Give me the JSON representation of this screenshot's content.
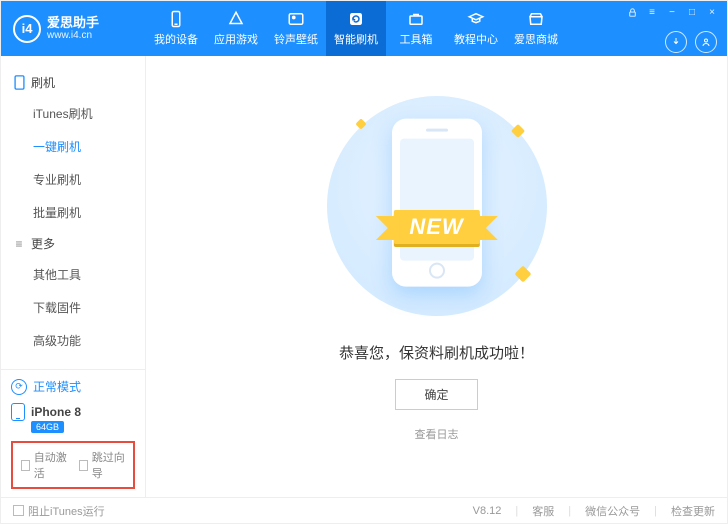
{
  "app": {
    "name": "爱思助手",
    "url": "www.i4.cn",
    "logo_text": "i4"
  },
  "nav": {
    "items": [
      {
        "label": "我的设备"
      },
      {
        "label": "应用游戏"
      },
      {
        "label": "铃声壁纸"
      },
      {
        "label": "智能刷机"
      },
      {
        "label": "工具箱"
      },
      {
        "label": "教程中心"
      },
      {
        "label": "爱思商城"
      }
    ],
    "active_index": 3
  },
  "window_controls": {
    "lock": "锁",
    "menu": "≡",
    "min": "−",
    "max": "□",
    "close": "×"
  },
  "sidebar": {
    "group1": {
      "title": "刷机",
      "items": [
        "iTunes刷机",
        "一键刷机",
        "专业刷机",
        "批量刷机"
      ],
      "active_index": 1
    },
    "group2": {
      "title": "更多",
      "items": [
        "其他工具",
        "下载固件",
        "高级功能"
      ]
    },
    "mode": {
      "label": "正常模式"
    },
    "device": {
      "name": "iPhone 8",
      "storage": "64GB"
    },
    "options": {
      "auto_activate": "自动激活",
      "skip_guide": "跳过向导"
    }
  },
  "main": {
    "ribbon": "NEW",
    "success_text": "恭喜您，保资料刷机成功啦！",
    "ok": "确定",
    "view_log": "查看日志"
  },
  "footer": {
    "block_itunes": "阻止iTunes运行",
    "version": "V8.12",
    "support": "客服",
    "wechat": "微信公众号",
    "update": "检查更新"
  }
}
